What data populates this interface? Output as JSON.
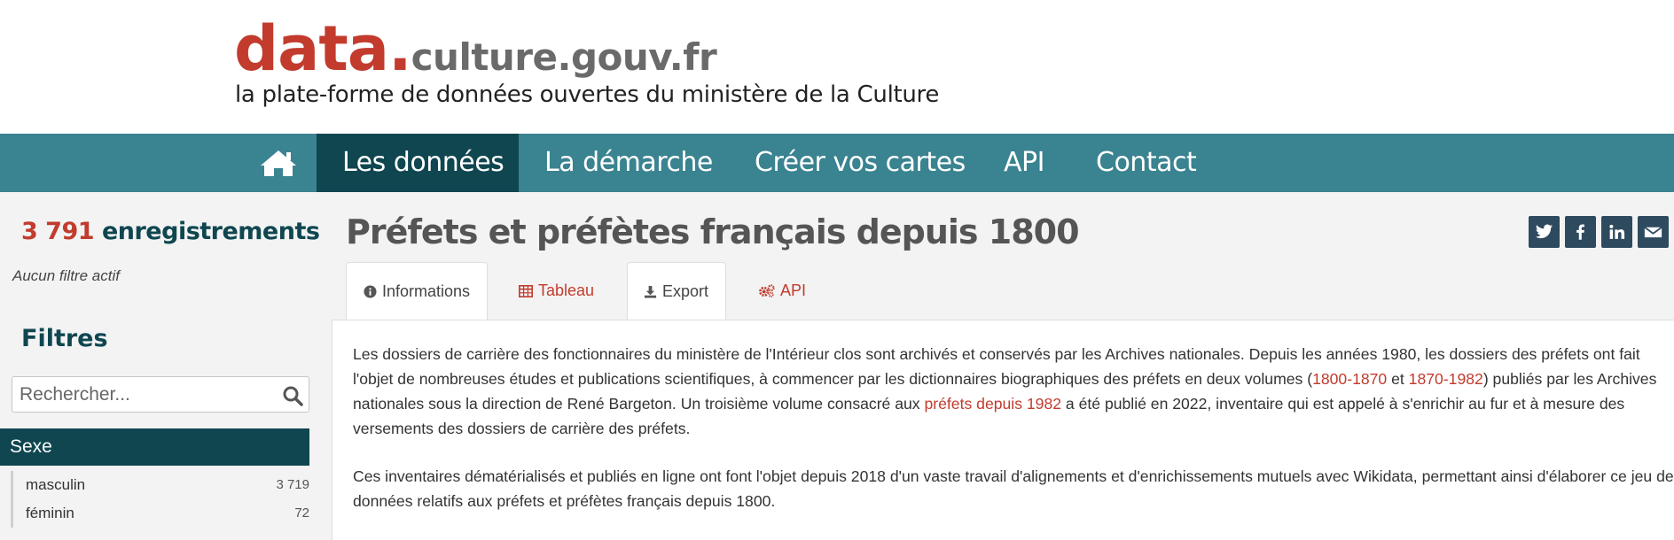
{
  "header": {
    "logo_main": "data.",
    "logo_rest": "culture.gouv.fr",
    "tagline": "la plate-forme de données ouvertes du ministère de la Culture"
  },
  "nav": {
    "home_icon": "home-icon",
    "items": [
      {
        "label": "Les données",
        "active": true
      },
      {
        "label": "La démarche",
        "active": false
      },
      {
        "label": "Créer vos cartes",
        "active": false
      },
      {
        "label": "API",
        "active": false
      },
      {
        "label": "Contact",
        "active": false
      }
    ]
  },
  "sidebar": {
    "count": "3 791",
    "count_label": "enregistrements",
    "no_filter": "Aucun filtre actif",
    "filters_title": "Filtres",
    "search_placeholder": "Rechercher...",
    "facet": {
      "title": "Sexe",
      "items": [
        {
          "label": "masculin",
          "count": "3 719"
        },
        {
          "label": "féminin",
          "count": "72"
        }
      ]
    }
  },
  "main": {
    "title": "Préfets et préfètes français depuis 1800",
    "share": [
      "twitter-icon",
      "facebook-icon",
      "linkedin-icon",
      "email-icon"
    ],
    "tabs": [
      {
        "label": "Informations",
        "icon": "info-circle-icon",
        "active": true
      },
      {
        "label": "Tableau",
        "icon": "table-icon",
        "active": false
      },
      {
        "label": "Export",
        "icon": "download-icon",
        "active": false
      },
      {
        "label": "API",
        "icon": "cogs-icon",
        "active": false
      }
    ],
    "para1": {
      "t1": "Les dossiers de carrière des fonctionnaires du ministère de l'Intérieur clos sont archivés et conservés par les Archives nationales. Depuis les années 1980, les dossiers des préfets ont fait l'objet de nombreuses études et publications scientifiques, à commencer par les dictionnaires biographiques des préfets en deux volumes (",
      "link1": "1800-1870",
      "t2": " et ",
      "link2": "1870-1982",
      "t3": ") publiés par les Archives nationales sous la direction de René Bargeton. Un troisième volume consacré aux ",
      "link3": "préfets depuis 1982",
      "t4": " a été publié en 2022, inventaire qui est appelé à s'enrichir au fur et à mesure des versements des dossiers de carrière des préfets."
    },
    "para2": "Ces inventaires dématérialisés et publiés en ligne ont font l'objet depuis 2018 d'un vaste travail d'alignements et d'enrichissements mutuels avec Wikidata, permettant ainsi d'élaborer ce jeu de données relatifs aux préfets et préfètes français depuis 1800."
  },
  "colors": {
    "brand_red": "#c23b2d",
    "nav_teal": "#3a8390",
    "nav_active": "#0f4650",
    "share_bg": "#2e4a5f"
  }
}
